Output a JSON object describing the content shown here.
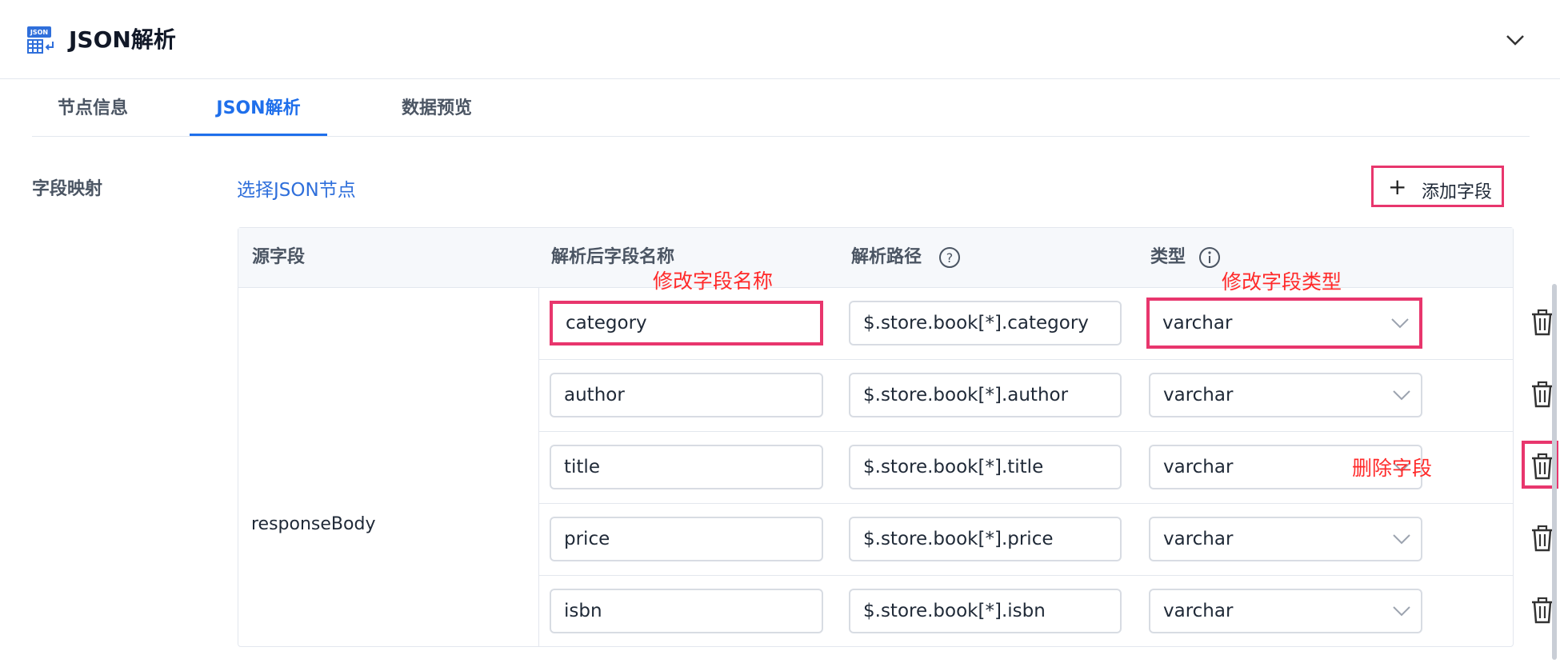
{
  "header": {
    "title": "JSON解析",
    "icon": "json-table-icon",
    "collapse_icon": "chevron-down-icon"
  },
  "tabs": [
    {
      "label": "节点信息",
      "active": false
    },
    {
      "label": "JSON解析",
      "active": true
    },
    {
      "label": "数据预览",
      "active": false
    }
  ],
  "mapping": {
    "label": "字段映射",
    "select_link": "选择JSON节点",
    "add_button": "添加字段"
  },
  "table": {
    "columns": [
      "源字段",
      "解析后字段名称",
      "解析路径",
      "类型"
    ],
    "source_field": "responseBody",
    "rows": [
      {
        "name": "category",
        "path": "$.store.book[*].category",
        "type": "varchar"
      },
      {
        "name": "author",
        "path": "$.store.book[*].author",
        "type": "varchar"
      },
      {
        "name": "title",
        "path": "$.store.book[*].title",
        "type": "varchar"
      },
      {
        "name": "price",
        "path": "$.store.book[*].price",
        "type": "varchar"
      },
      {
        "name": "isbn",
        "path": "$.store.book[*].isbn",
        "type": "varchar"
      }
    ]
  },
  "annotations": {
    "rename": "修改字段名称",
    "retype": "修改字段类型",
    "delete": "删除字段"
  },
  "colors": {
    "accent": "#1f6feb",
    "highlight": "#e8366d",
    "annotation": "#ff2a2a"
  }
}
